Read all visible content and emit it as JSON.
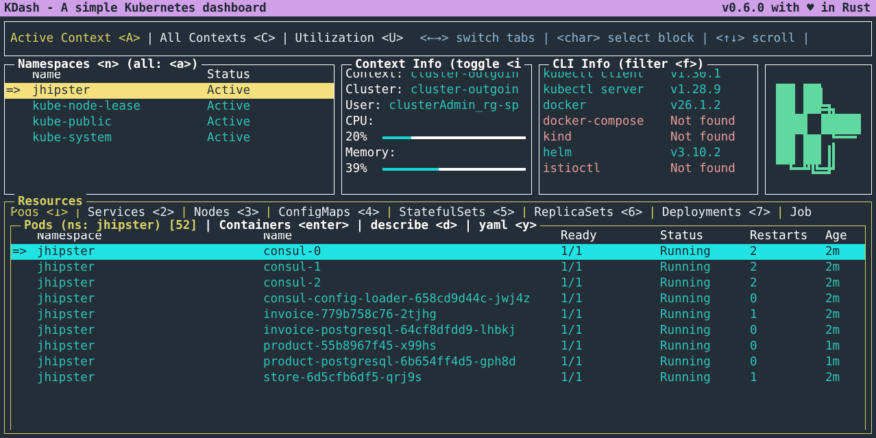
{
  "titlebar": {
    "title": "KDash - A simple Kubernetes dashboard",
    "version_prefix": "v0.6.0 with ",
    "heart": "♥",
    "version_suffix": " in Rust"
  },
  "nav": {
    "tabs": [
      {
        "label": "Active Context <A>",
        "active": true
      },
      {
        "label": "All Contexts <C>",
        "active": false
      },
      {
        "label": "Utilization <U>",
        "active": false
      }
    ],
    "separator": "|",
    "hints": "<←→> switch tabs | <char> select block | <↑↓> scroll |"
  },
  "namespaces": {
    "title": "Namespaces <n> (all: <a>)",
    "columns": [
      "Name",
      "Status"
    ],
    "marker": "=>",
    "rows": [
      {
        "name": "jhipster",
        "status": "Active",
        "selected": true
      },
      {
        "name": "kube-node-lease",
        "status": "Active",
        "selected": false
      },
      {
        "name": "kube-public",
        "status": "Active",
        "selected": false
      },
      {
        "name": "kube-system",
        "status": "Active",
        "selected": false
      }
    ]
  },
  "context_info": {
    "title": "Context Info (toggle <i",
    "context_label": "Context: ",
    "context_value": "cluster-outgoin",
    "cluster_label": "Cluster: ",
    "cluster_value": "cluster-outgoin",
    "user_label": "User: ",
    "user_value": "clusterAdmin_rg-sp",
    "cpu_label": "CPU:",
    "cpu_pct_text": "20%",
    "cpu_pct": 20,
    "memory_label": "Memory:",
    "memory_pct_text": "39%",
    "memory_pct": 39
  },
  "cli_info": {
    "title": "CLI Info (filter <f>)",
    "rows": [
      {
        "name": "kubectl client",
        "version": "v1.30.1",
        "found": true
      },
      {
        "name": "kubectl server",
        "version": "v1.28.9",
        "found": true
      },
      {
        "name": "docker",
        "version": "v26.1.2",
        "found": true
      },
      {
        "name": "docker-compose",
        "version": "Not found",
        "found": false
      },
      {
        "name": "kind",
        "version": "Not found",
        "found": false
      },
      {
        "name": "helm",
        "version": "v3.10.2",
        "found": true
      },
      {
        "name": "istioctl",
        "version": "Not found",
        "found": false
      }
    ]
  },
  "logo": {
    "name": "kdash-k-logo",
    "color": "#5fd9a0"
  },
  "resources": {
    "title": "Resources",
    "separator": "|",
    "tabs": [
      {
        "label": "Pods <1>",
        "active": true
      },
      {
        "label": "Services <2>",
        "active": false
      },
      {
        "label": "Nodes <3>",
        "active": false
      },
      {
        "label": "ConfigMaps <4>",
        "active": false
      },
      {
        "label": "StatefulSets <5>",
        "active": false
      },
      {
        "label": "ReplicaSets <6>",
        "active": false
      },
      {
        "label": "Deployments <7>",
        "active": false
      },
      {
        "label": "Job",
        "active": false
      }
    ]
  },
  "pods": {
    "title_yellow": "Pods (ns: jhipster) [52]",
    "title_white": " | Containers <enter> | describe <d> | yaml <y>",
    "marker": "=>",
    "columns": [
      "Namespace",
      "Name",
      "Ready",
      "Status",
      "Restarts",
      "Age"
    ],
    "rows": [
      {
        "namespace": "jhipster",
        "name": "consul-0",
        "ready": "1/1",
        "status": "Running",
        "restarts": "2",
        "age": "2m",
        "selected": true
      },
      {
        "namespace": "jhipster",
        "name": "consul-1",
        "ready": "1/1",
        "status": "Running",
        "restarts": "2",
        "age": "2m",
        "selected": false
      },
      {
        "namespace": "jhipster",
        "name": "consul-2",
        "ready": "1/1",
        "status": "Running",
        "restarts": "2",
        "age": "2m",
        "selected": false
      },
      {
        "namespace": "jhipster",
        "name": "consul-config-loader-658cd9d44c-jwj4z",
        "ready": "1/1",
        "status": "Running",
        "restarts": "0",
        "age": "2m",
        "selected": false
      },
      {
        "namespace": "jhipster",
        "name": "invoice-779b758c76-2tjhg",
        "ready": "1/1",
        "status": "Running",
        "restarts": "1",
        "age": "2m",
        "selected": false
      },
      {
        "namespace": "jhipster",
        "name": "invoice-postgresql-64cf8dfdd9-lhbkj",
        "ready": "1/1",
        "status": "Running",
        "restarts": "0",
        "age": "2m",
        "selected": false
      },
      {
        "namespace": "jhipster",
        "name": "product-55b8967f45-x99hs",
        "ready": "1/1",
        "status": "Running",
        "restarts": "0",
        "age": "1m",
        "selected": false
      },
      {
        "namespace": "jhipster",
        "name": "product-postgresql-6b654ff4d5-gph8d",
        "ready": "1/1",
        "status": "Running",
        "restarts": "0",
        "age": "1m",
        "selected": false
      },
      {
        "namespace": "jhipster",
        "name": "store-6d5cfb6df5-qrj9s",
        "ready": "1/1",
        "status": "Running",
        "restarts": "1",
        "age": "2m",
        "selected": false
      }
    ]
  }
}
